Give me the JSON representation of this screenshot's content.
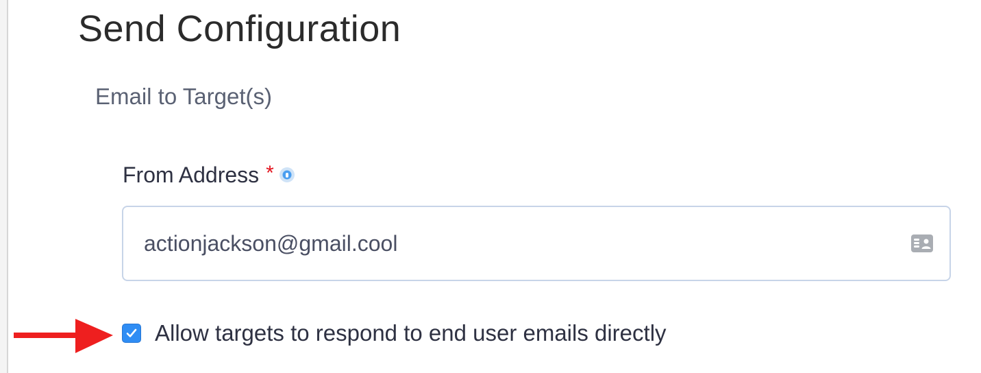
{
  "page": {
    "title": "Send Configuration"
  },
  "section": {
    "title": "Email to Target(s)"
  },
  "from_address": {
    "label": "From Address",
    "required_mark": "*",
    "value": "actionjackson@gmail.cool",
    "help_icon": "info-icon",
    "trailing_icon": "contact-card-icon"
  },
  "allow_direct_response": {
    "label": "Allow targets to respond to end user emails directly",
    "checked": true
  },
  "annotation": {
    "icon": "red-arrow-icon",
    "color": "#ee1f1f"
  },
  "colors": {
    "accent": "#2f8df4",
    "required": "#e3141e",
    "input_border": "#c7d4e8"
  }
}
